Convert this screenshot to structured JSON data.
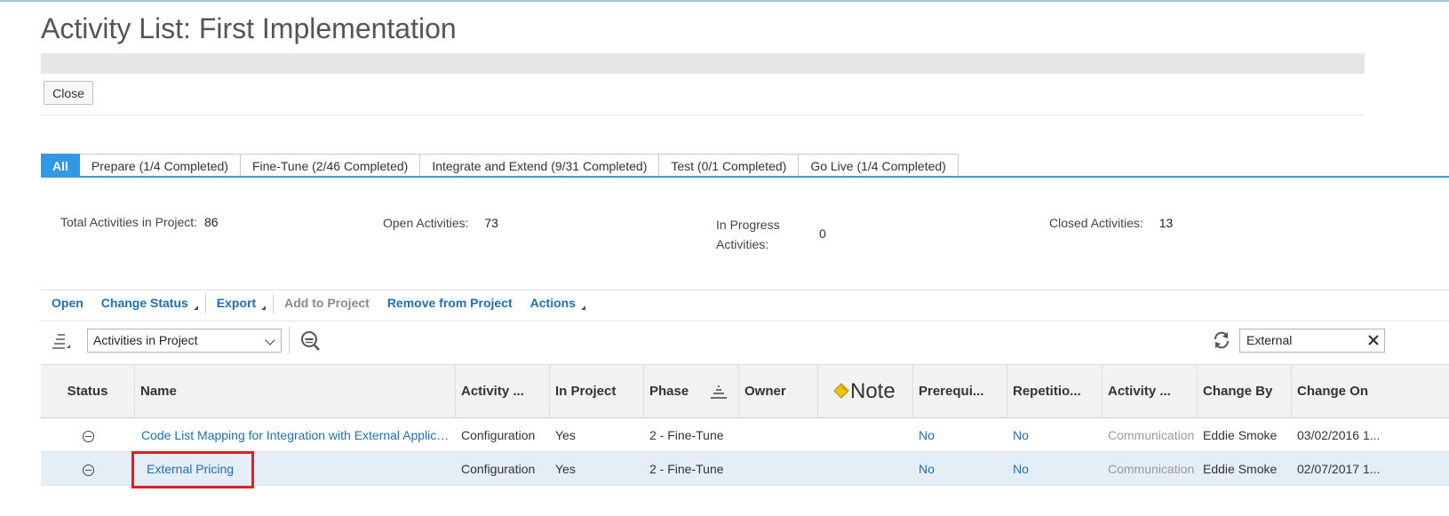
{
  "page": {
    "title": "Activity List: First Implementation"
  },
  "actions": {
    "close_label": "Close"
  },
  "tabs": [
    {
      "label": "All",
      "active": true
    },
    {
      "label": "Prepare (1/4 Completed)",
      "active": false
    },
    {
      "label": "Fine-Tune (2/46 Completed)",
      "active": false
    },
    {
      "label": "Integrate and Extend (9/31 Completed)",
      "active": false
    },
    {
      "label": "Test (0/1 Completed)",
      "active": false
    },
    {
      "label": "Go Live (1/4 Completed)",
      "active": false
    }
  ],
  "stats": {
    "total_label": "Total Activities in Project:",
    "total_value": "86",
    "open_label": "Open Activities:",
    "open_value": "73",
    "inprogress_label_1": "In Progress",
    "inprogress_label_2": "Activities:",
    "inprogress_value": "0",
    "closed_label": "Closed Activities:",
    "closed_value": "13"
  },
  "toolbar": {
    "open": "Open",
    "change_status": "Change Status",
    "export": "Export",
    "add_to_project": "Add to Project",
    "remove_from_project": "Remove from Project",
    "actions": "Actions"
  },
  "filter": {
    "view_selected": "Activities in Project",
    "search_value": "External"
  },
  "table": {
    "headers": {
      "status": "Status",
      "name": "Name",
      "activity_type": "Activity ...",
      "in_project": "In Project",
      "phase": "Phase",
      "owner": "Owner",
      "note": "Note",
      "prerequisite": "Prerequi...",
      "repetition": "Repetitio...",
      "activity2": "Activity ...",
      "change_by": "Change By",
      "change_on": "Change On"
    },
    "rows": [
      {
        "name": "Code List Mapping for Integration with External Applications",
        "activity_type": "Configuration",
        "in_project": "Yes",
        "phase": "2 - Fine-Tune",
        "owner": "",
        "note": "",
        "prerequisite": "No",
        "repetition": "No",
        "activity2": "Communication",
        "change_by": "Eddie Smoke",
        "change_on": "03/02/2016 1..."
      },
      {
        "name": "External Pricing",
        "activity_type": "Configuration",
        "in_project": "Yes",
        "phase": "2 - Fine-Tune",
        "owner": "",
        "note": "",
        "prerequisite": "No",
        "repetition": "No",
        "activity2": "Communication",
        "change_by": "Eddie Smoke",
        "change_on": "02/07/2017 1..."
      }
    ]
  },
  "colors": {
    "accent": "#3399e6",
    "link": "#1f6fb2",
    "highlight_box": "#d42424",
    "note_icon": "#f2c200"
  }
}
